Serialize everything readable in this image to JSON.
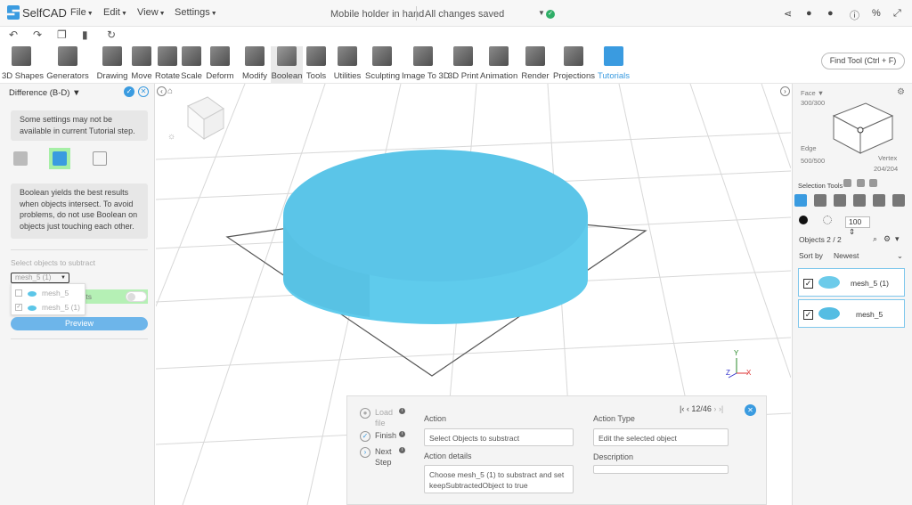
{
  "app": {
    "name": "SelfCAD"
  },
  "menu": {
    "file": "File",
    "edit": "Edit",
    "view": "View",
    "settings": "Settings"
  },
  "document": {
    "title": "Mobile holder in hand",
    "status": "All changes saved"
  },
  "toolbar": {
    "items": [
      {
        "label": "3D Shapes"
      },
      {
        "label": "Generators"
      },
      {
        "label": "Drawing"
      },
      {
        "label": "Move"
      },
      {
        "label": "Rotate"
      },
      {
        "label": "Scale"
      },
      {
        "label": "Deform"
      },
      {
        "label": "Modify"
      },
      {
        "label": "Boolean"
      },
      {
        "label": "Tools"
      },
      {
        "label": "Utilities"
      },
      {
        "label": "Sculpting"
      },
      {
        "label": "Image To 3D"
      },
      {
        "label": "3D Print"
      },
      {
        "label": "Animation"
      },
      {
        "label": "Render"
      },
      {
        "label": "Projections"
      },
      {
        "label": "Tutorials"
      }
    ],
    "find_tool": "Find Tool (Ctrl + F)"
  },
  "left_panel": {
    "title": "Difference (B-D)",
    "notice1": "Some settings may not be available in current Tutorial step.",
    "notice2": "Boolean yields the best results when objects intersect. To avoid problems, do not use Boolean on objects just touching each other.",
    "subtract_label": "Select objects to subtract",
    "select_value": "mesh_5 (1)",
    "keep_label": "...cts",
    "dropdown_items": [
      {
        "label": "mesh_5",
        "checked": false
      },
      {
        "label": "mesh_5 (1)",
        "checked": true
      }
    ],
    "preview": "Preview"
  },
  "tutorial": {
    "steps": [
      {
        "label": "Load file"
      },
      {
        "label": "Finish"
      },
      {
        "label": "Next Step"
      }
    ],
    "action_label": "Action",
    "action_value": "Select Objects to substract",
    "details_label": "Action details",
    "details_value": "Choose  mesh_5 (1) to substract and set keepSubtractedObject to true",
    "type_label": "Action Type",
    "type_value": "Edit the selected object",
    "description_label": "Description",
    "description_value": "",
    "nav": "12/46"
  },
  "right_panel": {
    "face_label": "Face",
    "face_count": "300/300",
    "edge_label": "Edge",
    "edge_count": "500/500",
    "vertex_label": "Vertex",
    "vertex_count": "204/204",
    "selection_tools": "Selection Tools",
    "size_value": "100",
    "objects_label": "Objects 2 / 2",
    "sort_label": "Sort by",
    "sort_value": "Newest",
    "objects": [
      {
        "name": "mesh_5 (1)"
      },
      {
        "name": "mesh_5"
      }
    ]
  },
  "axes": {
    "x": "X",
    "y": "Y",
    "z": "Z"
  },
  "colors": {
    "accent": "#3a9be0",
    "object": "#6ccbea",
    "active_green": "#a6efa6"
  }
}
